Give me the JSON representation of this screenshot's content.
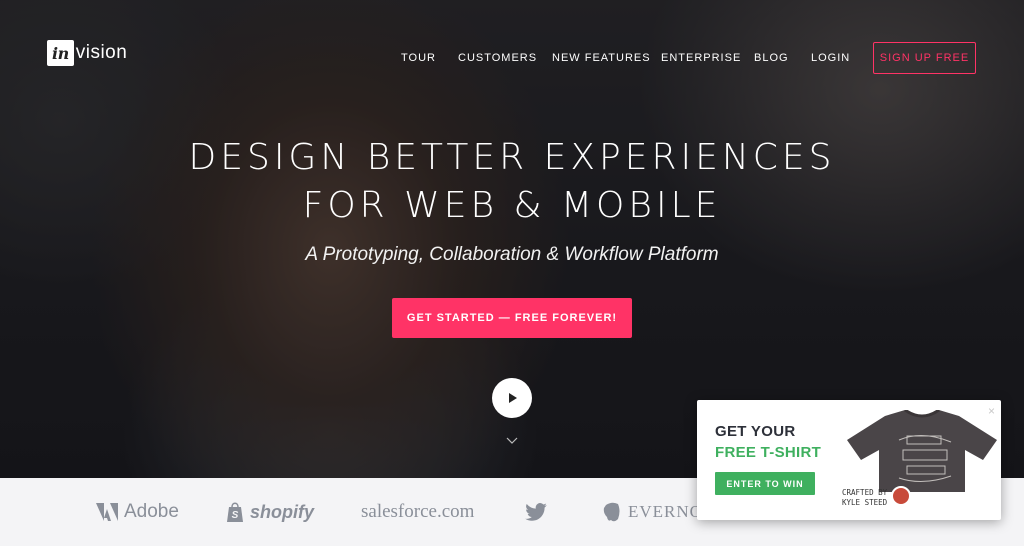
{
  "brand": {
    "logo_badge": "in",
    "logo_rest": "vision"
  },
  "nav": {
    "items": [
      "TOUR",
      "CUSTOMERS",
      "NEW FEATURES",
      "ENTERPRISE",
      "BLOG",
      "LOGIN"
    ],
    "signup": "SIGN UP FREE"
  },
  "hero": {
    "headline_line1": "DESIGN BETTER EXPERIENCES",
    "headline_line2": "FOR WEB & MOBILE",
    "subhead": "A Prototyping, Collaboration & Workflow Platform",
    "cta": "GET STARTED — FREE FOREVER!"
  },
  "logos": [
    "Adobe",
    "shopify",
    "salesforce.com",
    "EVERNOTE"
  ],
  "popup": {
    "line1": "GET YOUR",
    "line2": "FREE T-SHIRT",
    "button": "ENTER TO WIN",
    "crafted_by": "CRAFTED BY",
    "crafter": "KYLE STEED",
    "close": "×"
  },
  "colors": {
    "accent": "#ff3366",
    "green": "#3fb05f",
    "strip": "#f4f4f6"
  }
}
